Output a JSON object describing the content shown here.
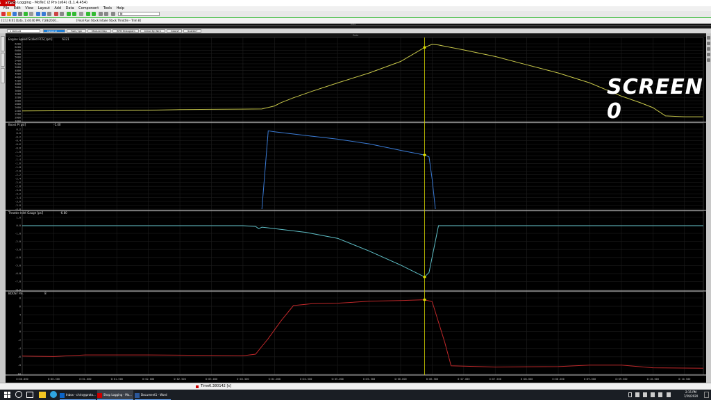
{
  "window": {
    "title": "Shop Logging - MoTeC i2 Pro (x64) (1.1.4.454)",
    "logo": "MoTeC",
    "minimize": "—",
    "maximize": "☐",
    "close": "✕"
  },
  "menu": [
    "File",
    "Edit",
    "View",
    "Layout",
    "Add",
    "Data",
    "Component",
    "Tools",
    "Help"
  ],
  "toolbar": {
    "select_value": "M"
  },
  "filebar": {
    "file": "[1:1] 6:01 Data, 1:44:40 PM, 7/28/2020...",
    "note": "[Final Run Stock Intake Stock Throttle - Trim 8]"
  },
  "center_label": "Data",
  "worksheet": {
    "selector": "1 Default",
    "tabs": [
      {
        "label": "General",
        "active": true
      },
      {
        "label": "Fuel / Ign",
        "active": false
      },
      {
        "label": "Mixture Map",
        "active": false
      },
      {
        "label": "RPM Histogram",
        "active": false
      },
      {
        "label": "Drive By Wire",
        "active": false
      },
      {
        "label": "Gears?",
        "active": false
      },
      {
        "label": "Scatter?",
        "active": false
      }
    ]
  },
  "graph_header": "Data",
  "plots": [
    {
      "label": "Engine Speed Scaled FCS [rpm]",
      "value": "6321",
      "color": "#c8c84a",
      "ticks": [
        "6400",
        "6200",
        "6000",
        "5800",
        "5600",
        "5400",
        "5200",
        "5000",
        "4800",
        "4600",
        "4400",
        "4200",
        "4000",
        "3800",
        "3600",
        "3400",
        "3200",
        "3000",
        "2800",
        "2600",
        "2400",
        "2200",
        "2000",
        "1800"
      ]
    },
    {
      "label": "Boost P [psi]",
      "value": "-1.40",
      "color": "#3a7bd5",
      "ticks": [
        "0.2",
        "0.0",
        "-0.2",
        "-0.4",
        "-0.6",
        "-0.8",
        "-1.0",
        "-1.2",
        "-1.4",
        "-1.6",
        "-1.8",
        "-2.0",
        "-2.2",
        "-2.4",
        "-2.6",
        "-2.8",
        "-3.0",
        "-3.2",
        "-3.4",
        "-3.6",
        "-3.8",
        "-4.0"
      ]
    },
    {
      "label": "Throttle Inlet Gauge [psi]",
      "value": "-6.80",
      "color": "#5fc0c8",
      "ticks": [
        "1.0",
        "0.0",
        "-1.0",
        "-2.0",
        "-3.0",
        "-4.0",
        "-5.0",
        "-6.0",
        "-7.0",
        "-8.0"
      ]
    },
    {
      "label": "BOOST P.E.",
      "value": "8",
      "color": "#c0282a",
      "ticks": [
        "8",
        "6",
        "4",
        "2",
        "0",
        "-2",
        "-4",
        "-6",
        "-8",
        "-10"
      ]
    }
  ],
  "chart_data": {
    "type": "line",
    "xlabel": "Time",
    "x_ticks": [
      "0:00.000",
      "0:00.500",
      "0:01.000",
      "0:01.500",
      "0:02.000",
      "0:02.500",
      "0:03.000",
      "0:03.500",
      "0:04.000",
      "0:04.500",
      "0:05.000",
      "0:05.500",
      "0:06.000",
      "0:06.500",
      "0:07.000",
      "0:07.500",
      "0:08.000",
      "0:08.500",
      "0:09.000",
      "0:09.500",
      "0:10.000",
      "0:10.500"
    ],
    "xlim": [
      0,
      10.8
    ],
    "cursor_time": 6.380142,
    "series": [
      {
        "name": "Engine Speed Scaled FCS [rpm]",
        "ylim": [
          1700,
          6500
        ],
        "points": [
          [
            0,
            2300
          ],
          [
            0.5,
            2310
          ],
          [
            1.0,
            2320
          ],
          [
            1.5,
            2330
          ],
          [
            2.0,
            2340
          ],
          [
            2.5,
            2380
          ],
          [
            3.0,
            2400
          ],
          [
            3.5,
            2410
          ],
          [
            3.8,
            2420
          ],
          [
            4.0,
            2600
          ],
          [
            4.1,
            2800
          ],
          [
            4.3,
            3100
          ],
          [
            4.6,
            3500
          ],
          [
            5.0,
            4000
          ],
          [
            5.5,
            4600
          ],
          [
            6.0,
            5300
          ],
          [
            6.38,
            6150
          ],
          [
            6.5,
            6340
          ],
          [
            6.6,
            6300
          ],
          [
            7.0,
            6000
          ],
          [
            7.5,
            5600
          ],
          [
            8.0,
            5100
          ],
          [
            8.5,
            4600
          ],
          [
            9.0,
            4000
          ],
          [
            9.5,
            3200
          ],
          [
            9.8,
            2800
          ],
          [
            10.0,
            2500
          ],
          [
            10.2,
            2000
          ],
          [
            10.5,
            1950
          ],
          [
            10.8,
            1950
          ]
        ]
      },
      {
        "name": "Boost P [psi]",
        "ylim": [
          -4.1,
          0.3
        ],
        "points": [
          [
            3.8,
            -4.1
          ],
          [
            3.9,
            0.1
          ],
          [
            4.0,
            0.05
          ],
          [
            4.5,
            -0.15
          ],
          [
            5.0,
            -0.35
          ],
          [
            5.5,
            -0.6
          ],
          [
            6.0,
            -0.95
          ],
          [
            6.38,
            -1.2
          ],
          [
            6.45,
            -1.3
          ],
          [
            6.5,
            -2.5
          ],
          [
            6.55,
            -4.1
          ]
        ]
      },
      {
        "name": "Throttle Inlet Gauge [psi]",
        "ylim": [
          -8.5,
          1.5
        ],
        "points": [
          [
            0,
            0.1
          ],
          [
            3.5,
            0.1
          ],
          [
            3.7,
            0.0
          ],
          [
            3.75,
            -0.3
          ],
          [
            3.8,
            -0.1
          ],
          [
            4.5,
            -0.8
          ],
          [
            5.0,
            -1.6
          ],
          [
            5.5,
            -3.3
          ],
          [
            6.0,
            -5.2
          ],
          [
            6.38,
            -6.8
          ],
          [
            6.45,
            -6.2
          ],
          [
            6.55,
            -2.0
          ],
          [
            6.6,
            0.1
          ],
          [
            10.8,
            0.1
          ]
        ]
      },
      {
        "name": "BOOST P.E.",
        "ylim": [
          -11,
          9
        ],
        "points": [
          [
            0,
            -6.5
          ],
          [
            0.5,
            -6.6
          ],
          [
            1.0,
            -6.2
          ],
          [
            2.0,
            -6.2
          ],
          [
            3.0,
            -6.3
          ],
          [
            3.5,
            -6.4
          ],
          [
            3.7,
            -6.0
          ],
          [
            3.9,
            -2.0
          ],
          [
            4.1,
            2.5
          ],
          [
            4.3,
            6.5
          ],
          [
            4.6,
            7.0
          ],
          [
            5.0,
            7.1
          ],
          [
            5.5,
            7.6
          ],
          [
            6.0,
            7.8
          ],
          [
            6.38,
            8.0
          ],
          [
            6.5,
            7.5
          ],
          [
            6.7,
            -3.0
          ],
          [
            6.8,
            -9.0
          ],
          [
            7.5,
            -9.3
          ],
          [
            8.5,
            -9.2
          ],
          [
            9.0,
            -8.8
          ],
          [
            9.5,
            -8.8
          ],
          [
            10.0,
            -9.5
          ],
          [
            10.8,
            -9.6
          ]
        ]
      }
    ]
  },
  "overlay_text": "SCREEN 0",
  "status": {
    "time_label": "Time",
    "time_value": "6.380142 [s]"
  },
  "taskbar": {
    "search": "",
    "tasks": [
      "Inbox - chris@proto...",
      "Shop Logging - Mo...",
      "Document1 - Word"
    ],
    "clock_time": "2:15 PM",
    "clock_date": "7/29/2020"
  }
}
